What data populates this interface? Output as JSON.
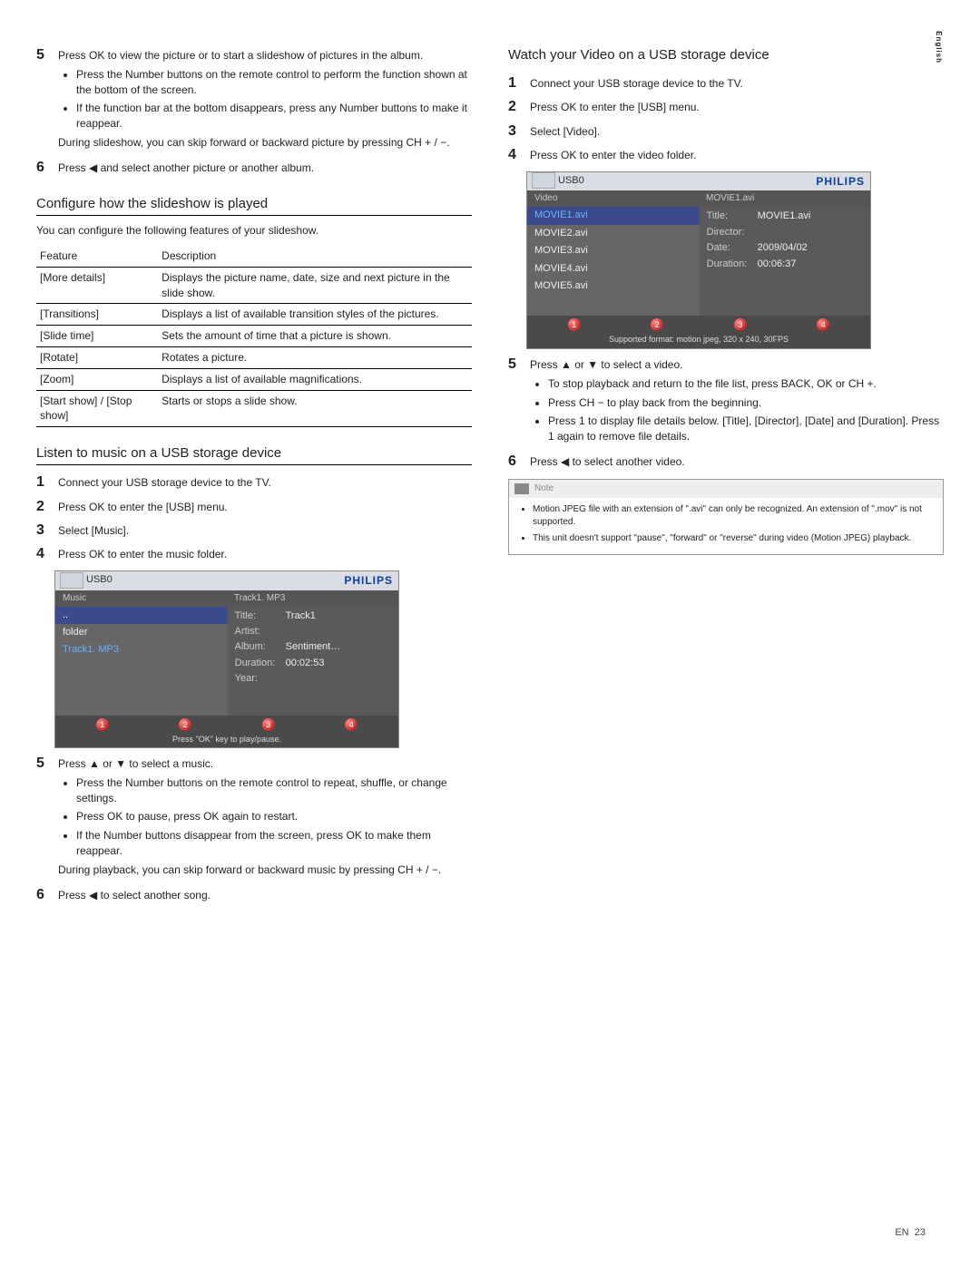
{
  "sideTab": "English",
  "left": {
    "step5": "Press OK to view the picture or to start a slideshow of pictures in the album.",
    "step5_bullets": [
      "Press the Number buttons on the remote control to perform the function shown at the bottom of the screen.",
      "If the function bar at the bottom disappears, press any Number buttons to make it reappear."
    ],
    "step5_after": "During slideshow, you can skip forward or backward picture by pressing CH + / −.",
    "step6": "Press ◀ and select another picture or another album.",
    "h_config": "Configure how the slideshow is played",
    "config_intro": "You can configure the following features of your slideshow.",
    "table_headers": [
      "Feature",
      "Description"
    ],
    "table_rows": [
      [
        "[More details]",
        "Displays the picture name, date, size and next picture in the slide show."
      ],
      [
        "[Transitions]",
        "Displays a list of available transition styles of the pictures."
      ],
      [
        "[Slide time]",
        "Sets the amount of time that a picture is shown."
      ],
      [
        "[Rotate]",
        "Rotates a picture."
      ],
      [
        "[Zoom]",
        "Displays a list of available magnifications."
      ],
      [
        "[Start show] / [Stop show]",
        "Starts or stops a slide show."
      ]
    ],
    "h_music": "Listen to music on a USB storage device",
    "msteps": [
      "Connect your USB storage device to the TV.",
      "Press OK to enter the [USB] menu.",
      "Select [Music].",
      "Press OK to enter the music folder."
    ],
    "ui_music": {
      "device": "USB0",
      "logo": "PHILIPS",
      "path": "Music",
      "path2": "Track1. MP3",
      "list": [
        "..",
        "folder",
        "Track1. MP3"
      ],
      "meta": {
        "Title:": "Track1",
        "Artist:": "",
        "Album:": "Sentiment…",
        "Duration:": "00:02:53",
        "Year:": ""
      },
      "hint": "Press \"OK\" key to play/pause."
    },
    "mstep5": "Press ▲ or ▼ to select a music.",
    "mstep5_bullets": [
      "Press the Number buttons on the remote control to repeat, shuffle, or change settings.",
      "Press OK to pause, press OK again to restart.",
      "If the Number buttons disappear from the screen, press OK to make them reappear."
    ],
    "mstep5_after": "During playback, you can skip forward or backward music by pressing CH + / −.",
    "mstep6": "Press ◀ to select another song."
  },
  "right": {
    "h_video": "Watch your Video on a USB storage device",
    "vsteps": [
      "Connect your USB storage device to the TV.",
      "Press OK to enter the [USB] menu.",
      "Select [Video].",
      "Press OK to enter the video folder."
    ],
    "ui_video": {
      "device": "USB0",
      "logo": "PHILIPS",
      "path": "Video",
      "path2": "MOVIE1.avi",
      "list": [
        "MOVIE1.avi",
        "MOVIE2.avi",
        "MOVIE3.avi",
        "MOVIE4.avi",
        "MOVIE5.avi"
      ],
      "meta": {
        "Title:": "MOVIE1.avi",
        "Director:": "",
        "Date:": "2009/04/02",
        "Duration:": "00:06:37"
      },
      "hint": "Supported format: motion jpeg, 320 x 240, 30FPS"
    },
    "vstep5": "Press ▲ or ▼ to select a video.",
    "vstep5_bullets": [
      "To stop playback and return to the file list, press BACK, OK or CH +.",
      "Press CH − to play back from the beginning.",
      "Press 1 to display file details below. [Title], [Director], [Date] and [Duration]. Press 1 again to remove file details."
    ],
    "vstep6": "Press ◀ to select another video.",
    "note_label": "Note",
    "notes": [
      "Motion JPEG file with an extension of \".avi\" can only be recognized. An extension of \".mov\" is not supported.",
      "This unit doesn't support \"pause\", \"forward\" or \"reverse\" during video (Motion JPEG) playback."
    ]
  },
  "footer": {
    "lang": "EN",
    "page": "23"
  }
}
